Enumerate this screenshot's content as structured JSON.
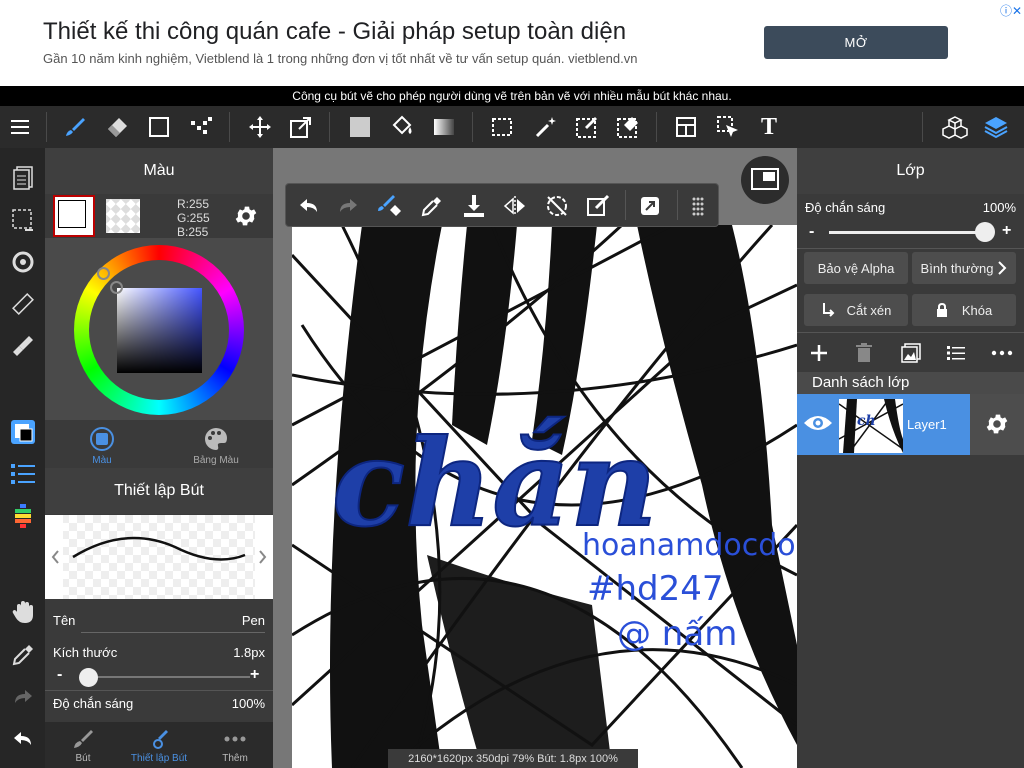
{
  "ad": {
    "title": "Thiết kế thi công quán cafe - Giải pháp setup toàn diện",
    "subtitle": "Gần 10 năm kinh nghiệm, Vietblend là 1 trong những đơn vị tốt nhất về tư vấn setup quán. vietblend.vn",
    "button": "MỞ",
    "info_icon": "ⓘ✕"
  },
  "tooltip": "Công cụ bút vẽ cho phép người dùng vẽ trên bản vẽ với nhiều mẫu bút khác nhau.",
  "toolbar": {
    "icons": [
      "menu-icon",
      "brush-icon",
      "eraser-icon",
      "rectangle-icon",
      "dot-pattern-icon",
      "move-icon",
      "transform-icon",
      "fill-color-icon",
      "bucket-icon",
      "gradient-icon",
      "select-rect-icon",
      "magic-wand-icon",
      "select-pen-icon",
      "select-eraser-icon",
      "frame-icon",
      "pointer-icon",
      "text-icon",
      "3d-cube-icon",
      "layers-icon"
    ],
    "text_tool": "T"
  },
  "color_panel": {
    "title": "Màu",
    "rgb": {
      "r": "R:255",
      "g": "G:255",
      "b": "B:255"
    },
    "tabs": [
      {
        "label": "Màu"
      },
      {
        "label": "Bảng Màu"
      }
    ],
    "accent": "#4a90e2"
  },
  "brush_panel": {
    "title": "Thiết lập Bút",
    "name_label": "Tên",
    "name_value": "Pen",
    "size_label": "Kích thước",
    "size_value": "1.8px",
    "size_minus": "-",
    "size_plus": "+",
    "opacity_label": "Độ chắn sáng",
    "opacity_value": "100%"
  },
  "bottom_tabs": [
    {
      "label": "Bút"
    },
    {
      "label": "Thiết lập Bút"
    },
    {
      "label": "Thêm"
    }
  ],
  "canvas": {
    "status": "2160*1620px 350dpi 79% Bút: 1.8px 100%",
    "handwriting": {
      "word": "chắn",
      "line1": "hoanamdocdo",
      "line2": "#hd247",
      "line3": "@ nấm"
    }
  },
  "layers_panel": {
    "title": "Lớp",
    "opacity_label": "Độ chắn sáng",
    "opacity_value": "100%",
    "opacity_minus": "-",
    "opacity_plus": "+",
    "alpha_button": "Bảo vệ Alpha",
    "blend_button": "Bình thường",
    "clip_button": "Cắt xén",
    "lock_button": "Khóa",
    "list_title": "Danh sách lớp",
    "layers": [
      {
        "name": "Layer1"
      }
    ]
  }
}
